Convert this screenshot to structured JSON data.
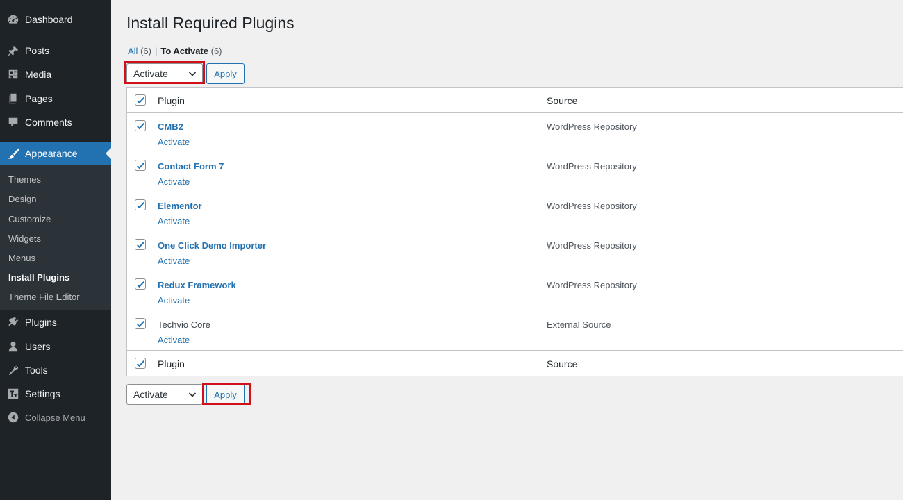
{
  "sidebar": {
    "dashboard": "Dashboard",
    "posts": "Posts",
    "media": "Media",
    "pages": "Pages",
    "comments": "Comments",
    "appearance": "Appearance",
    "sub": {
      "themes": "Themes",
      "design": "Design",
      "customize": "Customize",
      "widgets": "Widgets",
      "menus": "Menus",
      "install_plugins": "Install Plugins",
      "theme_file_editor": "Theme File Editor"
    },
    "plugins": "Plugins",
    "users": "Users",
    "tools": "Tools",
    "settings": "Settings",
    "collapse": "Collapse Menu"
  },
  "page": {
    "title": "Install Required Plugins",
    "filter_all": "All",
    "filter_all_count": "(6)",
    "separator": "|",
    "filter_activate": "To Activate",
    "filter_activate_count": "(6)"
  },
  "bulk": {
    "top_selected": "Activate",
    "bottom_selected": "Activate",
    "apply_label": "Apply"
  },
  "table": {
    "col_plugin": "Plugin",
    "col_source": "Source",
    "rows": [
      {
        "name": "CMB2",
        "action": "Activate",
        "source": "WordPress Repository"
      },
      {
        "name": "Contact Form 7",
        "action": "Activate",
        "source": "WordPress Repository"
      },
      {
        "name": "Elementor",
        "action": "Activate",
        "source": "WordPress Repository"
      },
      {
        "name": "One Click Demo Importer",
        "action": "Activate",
        "source": "WordPress Repository"
      },
      {
        "name": "Redux Framework",
        "action": "Activate",
        "source": "WordPress Repository"
      },
      {
        "name": "Techvio Core",
        "action": "Activate",
        "source": "External Source"
      }
    ]
  },
  "colors": {
    "sidebar_bg": "#1d2327",
    "submenu_bg": "#2c3338",
    "accent": "#2271b1",
    "highlight_box": "#d0111a"
  },
  "icons": {
    "dashboard": "dashboard-icon",
    "posts": "pin-icon",
    "media": "media-icon",
    "pages": "pages-icon",
    "comments": "comment-icon",
    "appearance": "brush-icon",
    "plugins": "plugin-icon",
    "users": "user-icon",
    "tools": "wrench-icon",
    "settings": "settings-icon",
    "collapse": "collapse-icon",
    "checkbox": "checkmark-icon",
    "select": "chevron-down-icon"
  }
}
